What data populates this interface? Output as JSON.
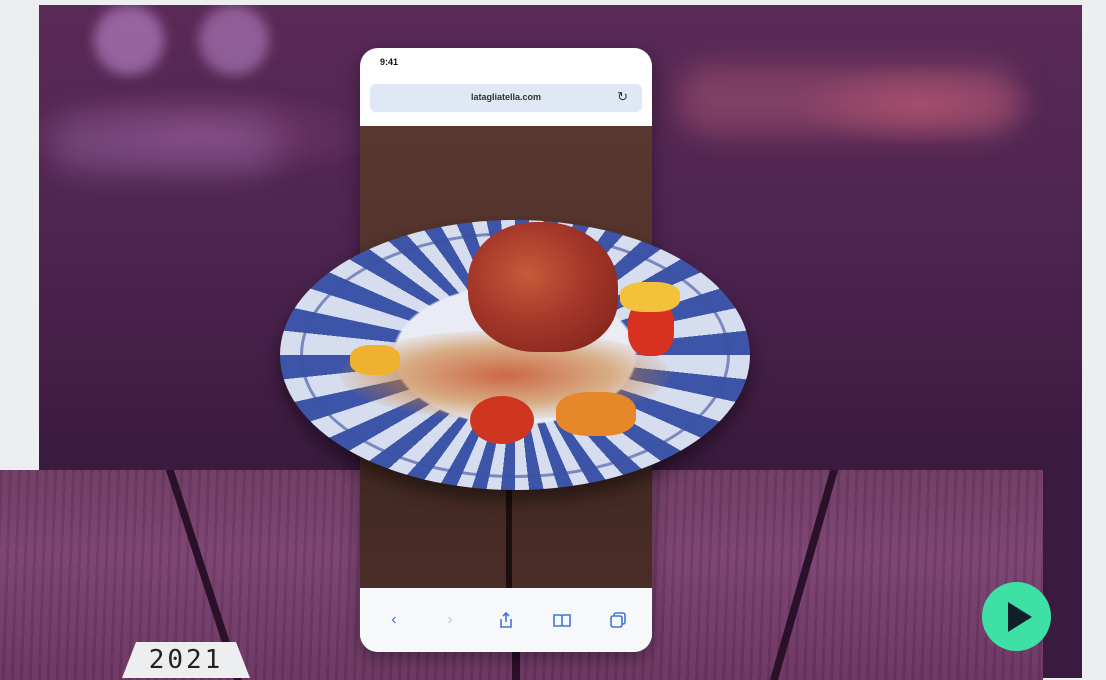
{
  "phone": {
    "status_time": "9:41",
    "url": "latagliatella.com",
    "icons": {
      "reload": "reload-icon",
      "back": "chevron-left-icon",
      "forward": "chevron-right-icon",
      "share": "share-icon",
      "bookmarks": "book-icon",
      "tabs": "tabs-icon"
    }
  },
  "year_label": "2021",
  "colors": {
    "play_button": "#3fe0a6",
    "accent_blue": "#3d78d6"
  }
}
